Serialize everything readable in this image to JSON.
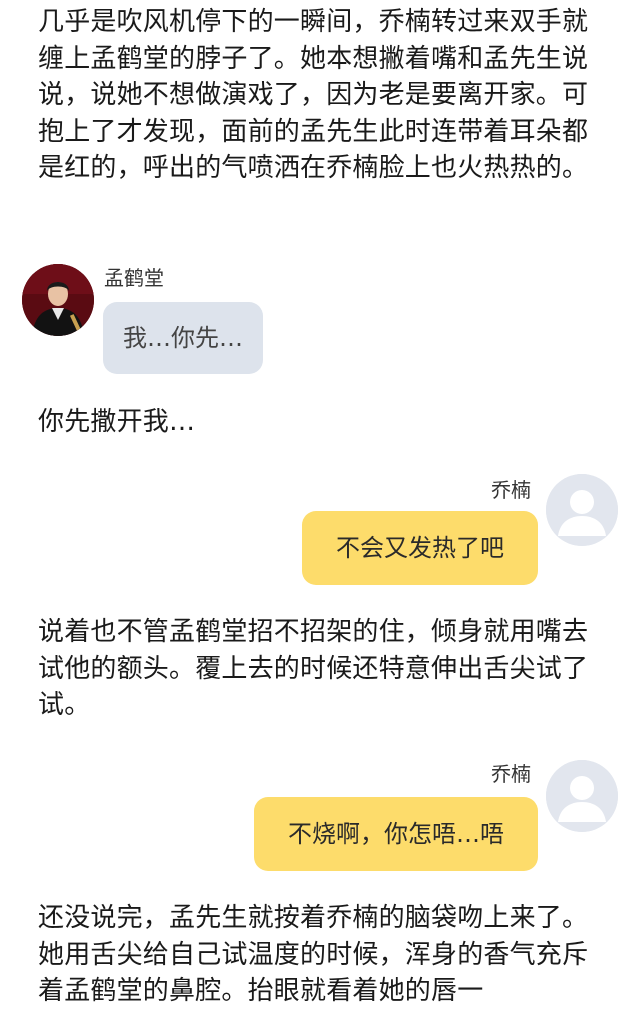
{
  "story": {
    "paragraph_1": "几乎是吹风机停下的一瞬间，乔楠转过来双手就缠上孟鹤堂的脖子了。她本想撇着嘴和孟先生说说，说她不想做演戏了，因为老是要离开家。可抱上了才发现，面前的孟先生此时连带着耳朵都是红的，呼出的气喷洒在乔楠脸上也火热热的。",
    "paragraph_2": "你先撒开我…",
    "paragraph_3": "说着也不管孟鹤堂招不招架的住，倾身就用嘴去试他的额头。覆上去的时候还特意伸出舌尖试了试。",
    "paragraph_4": "还没说完，孟先生就按着乔楠的脑袋吻上来了。她用舌尖给自己试温度的时候，浑身的香气充斥着孟鹤堂的鼻腔。抬眼就看着她的唇一"
  },
  "messages": [
    {
      "sender": "孟鹤堂",
      "text": "我…你先…",
      "side": "left",
      "bubble_color": "#dde3ec"
    },
    {
      "sender": "乔楠",
      "text": "不会又发热了吧",
      "side": "right",
      "bubble_color": "#fddc6b"
    },
    {
      "sender": "乔楠",
      "text": "不烧啊，你怎唔…唔",
      "side": "right",
      "bubble_color": "#fddc6b"
    }
  ],
  "icons": {
    "left_avatar": "person-photo-avatar",
    "right_avatar": "default-person-avatar-icon"
  }
}
